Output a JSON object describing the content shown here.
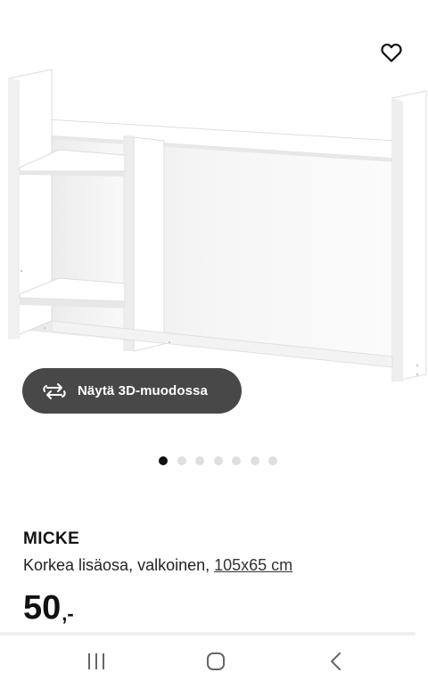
{
  "product": {
    "name": "MICKE",
    "description": "Korkea lisäosa, valkoinen, ",
    "dimensions": "105x65 cm",
    "price": "50",
    "price_suffix": ",-"
  },
  "gallery": {
    "view_3d_label": "Näytä 3D-muodossa",
    "dot_count": 7,
    "active_dot": 0
  },
  "icons": {
    "favorite": "heart-outline-icon",
    "view_3d": "rotate-3d-icon",
    "nav_recent": "recent-apps-icon",
    "nav_home": "home-icon",
    "nav_back": "back-icon"
  },
  "colors": {
    "button_bg": "#484848",
    "dot_active": "#111111",
    "dot_inactive": "#dfdfdf"
  }
}
